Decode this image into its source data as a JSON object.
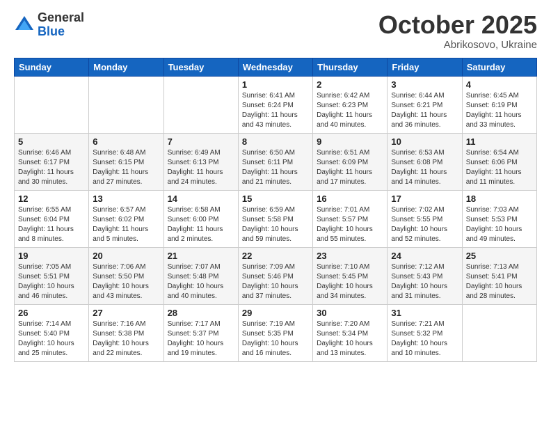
{
  "logo": {
    "general": "General",
    "blue": "Blue"
  },
  "header": {
    "month": "October 2025",
    "location": "Abrikosovo, Ukraine"
  },
  "weekdays": [
    "Sunday",
    "Monday",
    "Tuesday",
    "Wednesday",
    "Thursday",
    "Friday",
    "Saturday"
  ],
  "weeks": [
    [
      {
        "day": "",
        "info": ""
      },
      {
        "day": "",
        "info": ""
      },
      {
        "day": "",
        "info": ""
      },
      {
        "day": "1",
        "info": "Sunrise: 6:41 AM\nSunset: 6:24 PM\nDaylight: 11 hours\nand 43 minutes."
      },
      {
        "day": "2",
        "info": "Sunrise: 6:42 AM\nSunset: 6:23 PM\nDaylight: 11 hours\nand 40 minutes."
      },
      {
        "day": "3",
        "info": "Sunrise: 6:44 AM\nSunset: 6:21 PM\nDaylight: 11 hours\nand 36 minutes."
      },
      {
        "day": "4",
        "info": "Sunrise: 6:45 AM\nSunset: 6:19 PM\nDaylight: 11 hours\nand 33 minutes."
      }
    ],
    [
      {
        "day": "5",
        "info": "Sunrise: 6:46 AM\nSunset: 6:17 PM\nDaylight: 11 hours\nand 30 minutes."
      },
      {
        "day": "6",
        "info": "Sunrise: 6:48 AM\nSunset: 6:15 PM\nDaylight: 11 hours\nand 27 minutes."
      },
      {
        "day": "7",
        "info": "Sunrise: 6:49 AM\nSunset: 6:13 PM\nDaylight: 11 hours\nand 24 minutes."
      },
      {
        "day": "8",
        "info": "Sunrise: 6:50 AM\nSunset: 6:11 PM\nDaylight: 11 hours\nand 21 minutes."
      },
      {
        "day": "9",
        "info": "Sunrise: 6:51 AM\nSunset: 6:09 PM\nDaylight: 11 hours\nand 17 minutes."
      },
      {
        "day": "10",
        "info": "Sunrise: 6:53 AM\nSunset: 6:08 PM\nDaylight: 11 hours\nand 14 minutes."
      },
      {
        "day": "11",
        "info": "Sunrise: 6:54 AM\nSunset: 6:06 PM\nDaylight: 11 hours\nand 11 minutes."
      }
    ],
    [
      {
        "day": "12",
        "info": "Sunrise: 6:55 AM\nSunset: 6:04 PM\nDaylight: 11 hours\nand 8 minutes."
      },
      {
        "day": "13",
        "info": "Sunrise: 6:57 AM\nSunset: 6:02 PM\nDaylight: 11 hours\nand 5 minutes."
      },
      {
        "day": "14",
        "info": "Sunrise: 6:58 AM\nSunset: 6:00 PM\nDaylight: 11 hours\nand 2 minutes."
      },
      {
        "day": "15",
        "info": "Sunrise: 6:59 AM\nSunset: 5:58 PM\nDaylight: 10 hours\nand 59 minutes."
      },
      {
        "day": "16",
        "info": "Sunrise: 7:01 AM\nSunset: 5:57 PM\nDaylight: 10 hours\nand 55 minutes."
      },
      {
        "day": "17",
        "info": "Sunrise: 7:02 AM\nSunset: 5:55 PM\nDaylight: 10 hours\nand 52 minutes."
      },
      {
        "day": "18",
        "info": "Sunrise: 7:03 AM\nSunset: 5:53 PM\nDaylight: 10 hours\nand 49 minutes."
      }
    ],
    [
      {
        "day": "19",
        "info": "Sunrise: 7:05 AM\nSunset: 5:51 PM\nDaylight: 10 hours\nand 46 minutes."
      },
      {
        "day": "20",
        "info": "Sunrise: 7:06 AM\nSunset: 5:50 PM\nDaylight: 10 hours\nand 43 minutes."
      },
      {
        "day": "21",
        "info": "Sunrise: 7:07 AM\nSunset: 5:48 PM\nDaylight: 10 hours\nand 40 minutes."
      },
      {
        "day": "22",
        "info": "Sunrise: 7:09 AM\nSunset: 5:46 PM\nDaylight: 10 hours\nand 37 minutes."
      },
      {
        "day": "23",
        "info": "Sunrise: 7:10 AM\nSunset: 5:45 PM\nDaylight: 10 hours\nand 34 minutes."
      },
      {
        "day": "24",
        "info": "Sunrise: 7:12 AM\nSunset: 5:43 PM\nDaylight: 10 hours\nand 31 minutes."
      },
      {
        "day": "25",
        "info": "Sunrise: 7:13 AM\nSunset: 5:41 PM\nDaylight: 10 hours\nand 28 minutes."
      }
    ],
    [
      {
        "day": "26",
        "info": "Sunrise: 7:14 AM\nSunset: 5:40 PM\nDaylight: 10 hours\nand 25 minutes."
      },
      {
        "day": "27",
        "info": "Sunrise: 7:16 AM\nSunset: 5:38 PM\nDaylight: 10 hours\nand 22 minutes."
      },
      {
        "day": "28",
        "info": "Sunrise: 7:17 AM\nSunset: 5:37 PM\nDaylight: 10 hours\nand 19 minutes."
      },
      {
        "day": "29",
        "info": "Sunrise: 7:19 AM\nSunset: 5:35 PM\nDaylight: 10 hours\nand 16 minutes."
      },
      {
        "day": "30",
        "info": "Sunrise: 7:20 AM\nSunset: 5:34 PM\nDaylight: 10 hours\nand 13 minutes."
      },
      {
        "day": "31",
        "info": "Sunrise: 7:21 AM\nSunset: 5:32 PM\nDaylight: 10 hours\nand 10 minutes."
      },
      {
        "day": "",
        "info": ""
      }
    ]
  ]
}
